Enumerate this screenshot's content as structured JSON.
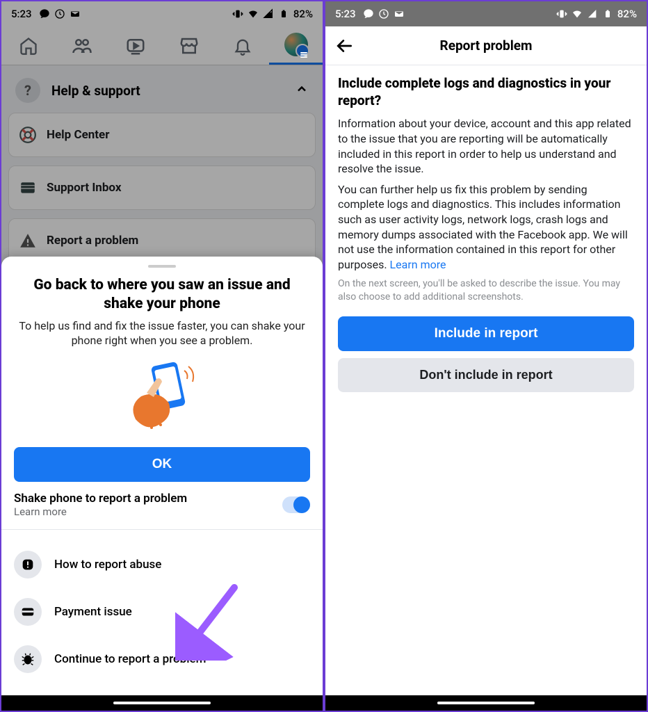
{
  "status": {
    "time": "5:23",
    "battery": "82%"
  },
  "left": {
    "help_header": "Help & support",
    "cards": {
      "help_center": "Help Center",
      "support_inbox": "Support Inbox",
      "report_problem": "Report a problem"
    },
    "sheet": {
      "title": "Go back to where you saw an issue and shake your phone",
      "subtitle": "To help us find and fix the issue faster, you can shake your phone right when you see a problem.",
      "ok_button": "OK",
      "shake_label": "Shake phone to report a problem",
      "learn_more": "Learn more",
      "items": {
        "abuse": "How to report abuse",
        "payment": "Payment issue",
        "continue": "Continue to report a problem"
      }
    }
  },
  "right": {
    "header": "Report problem",
    "question": "Include complete logs and diagnostics in your report?",
    "para1": "Information about your device, account and this app related to the issue that you are reporting will be automatically included in this report in order to help us understand and resolve the issue.",
    "para2": "You can further help us fix this problem by sending complete logs and diagnostics. This includes information such as user activity logs, network logs, crash logs and memory dumps associated with the Facebook app. We will not use the information contained in this report for other purposes. ",
    "learn_more": "Learn more",
    "hint": "On the next screen, you'll be asked to describe the issue. You may also choose to add additional screenshots.",
    "include_btn": "Include in report",
    "dont_include_btn": "Don't include in report"
  }
}
